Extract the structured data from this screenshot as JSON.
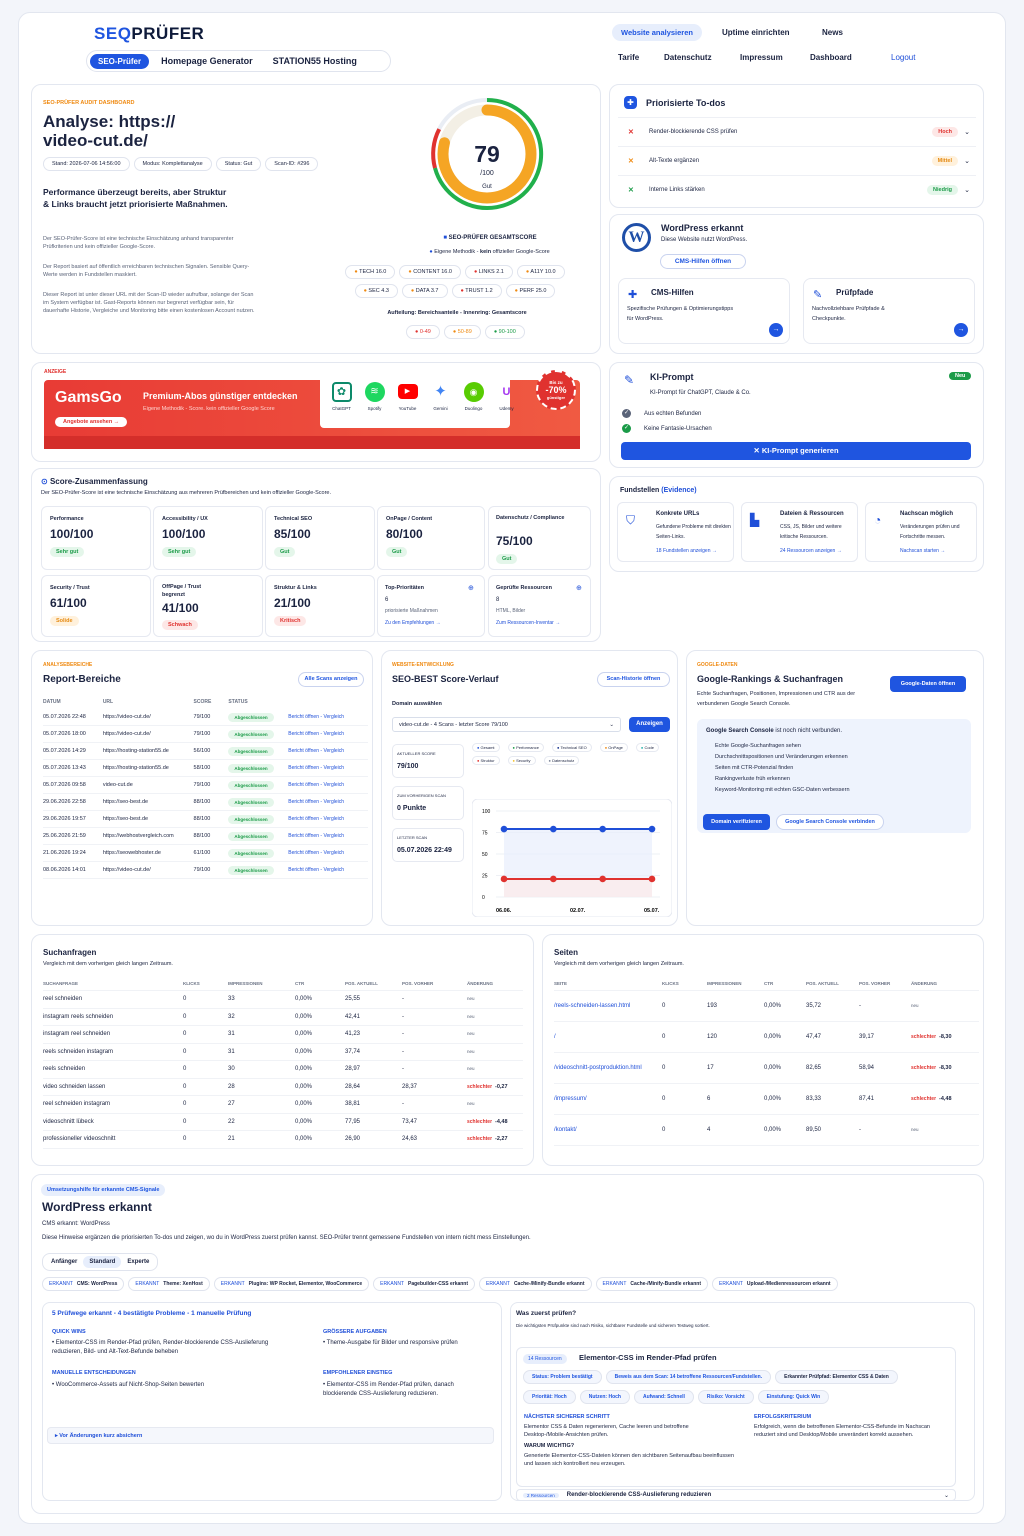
{
  "brand": {
    "seo": "SE",
    "o": "Q",
    "rest": "PRÜFER"
  },
  "topnav": {
    "tabs": [
      "SEO-Prüfer",
      "Homepage Generator",
      "STATION55 Hosting"
    ],
    "links_row1": [
      "Website analysieren",
      "Uptime einrichten",
      "News"
    ],
    "links_row2": [
      "Tarife",
      "Datenschutz",
      "Impressum",
      "Dashboard",
      "Logout"
    ]
  },
  "audit": {
    "kicker": "SEO-PRÜFER AUDIT DASHBOARD",
    "title_line1": "Analyse: https://",
    "title_line2": "video-cut.de/",
    "meta": [
      "Stand: 2026-07-06 14:56:00",
      "Modus: Komplettanalyse",
      "Status: Gut",
      "Scan-ID: #296"
    ],
    "headline": "Performance überzeugt bereits, aber Struktur & Links braucht jetzt priorisierte Maßnahmen.",
    "p1": "Der SEO-Prüfer-Score ist eine technische Einschätzung anhand transparenter Prüfkriterien und kein offizieller Google-Score.",
    "p2": "Der Report basiert auf öffentlich erreichbaren technischen Signalen. Sensible Query-Werte werden in Fundstellen maskiert.",
    "p3": "Dieser Report ist unter dieser URL mit der Scan-ID wieder aufrufbar, solange der Scan im System verfügbar ist. Gast-Reports können nur begrenzt verfügbar sein, für dauerhafte Historie, Vergleiche und Monitoring bitte einen kostenlosen Account nutzen.",
    "score": "79",
    "score_max": "/100",
    "score_label": "Gut",
    "score_value": 79,
    "gesamt": "SEO-PRÜFER GESAMTSCORE",
    "method_a": "Eigene Methodik - ",
    "method_b": "kein",
    "method_c": " offizieller Google-Score",
    "chips": [
      "TECH 16.0",
      "CONTENT 16.0",
      "LINKS 2.1",
      "A11Y 10.0",
      "SEC 4.3",
      "DATA 3.7",
      "TRUST 1.2",
      "PERF 25.0"
    ],
    "legend_title": "Aufteilung: Bereichsanteile - Innenring: Gesamtscore",
    "legend": [
      "0-49",
      "50-89",
      "90-100"
    ]
  },
  "todos": {
    "title": "Priorisierte To-dos",
    "items": [
      {
        "label": "Render-blockierende CSS prüfen",
        "tag": "Hoch"
      },
      {
        "label": "Alt-Texte ergänzen",
        "tag": "Mittel"
      },
      {
        "label": "Interne Links stärken",
        "tag": "Niedrig"
      }
    ]
  },
  "wp": {
    "title": "WordPress erkannt",
    "sub": "Diese Website nutzt WordPress.",
    "btn": "CMS-Hilfen öffnen",
    "cms_title": "CMS-Hilfen",
    "cms_text": "Spezifische Prüfungen & Optimierungstipps für WordPress.",
    "pp_title": "Prüfpfade",
    "pp_text": "Nachvollziehbare Prüfpfade & Checkpunkte."
  },
  "ad": {
    "label": "ANZEIGE",
    "brand": "GamsGo",
    "title": "Premium-Abos günstiger entdecken",
    "sub": "Eigene Methodik - Score. kein offizieller Google Score",
    "cta": "Angebote ansehen →",
    "apps": [
      "ChatGPT",
      "Spotify",
      "YouTube",
      "Gemini",
      "Duolingo",
      "Udemy"
    ],
    "badge1": "Bis zu",
    "badge2": "-70%",
    "badge3": "günstiger"
  },
  "ki": {
    "title": "KI-Prompt",
    "badge": "Neu",
    "sub": "KI-Prompt für ChatGPT, Claude & Co.",
    "c1": "Aus echten Befunden",
    "c2": "Keine Fantasie-Ursachen",
    "btn": "KI-Prompt generieren"
  },
  "fund": {
    "title_a": "Fundstellen ",
    "title_b": "(Evidence)",
    "items": [
      {
        "title": "Konkrete URLs",
        "text": "Gefundene Probleme mit direkten Seiten-Links.",
        "link": "18 Fundstellen anzeigen →"
      },
      {
        "title": "Dateien & Ressourcen",
        "text": "CSS, JS, Bilder und weitere kritische Ressourcen.",
        "link": "24 Ressourcen anzeigen →"
      },
      {
        "title": "Nachscan möglich",
        "text": "Veränderungen prüfen und Fortschritte messen.",
        "link": "Nachscan starten →"
      }
    ]
  },
  "summary": {
    "title": "Score-Zusammenfassung",
    "sub": "Der SEO-Prüfer-Score ist eine technische Einschätzung aus mehreren Prüfbereichen und kein offizieller Google-Score.",
    "cards": [
      {
        "label": "Performance",
        "value": "100/100",
        "tag": "Sehr gut",
        "c": "g"
      },
      {
        "label": "Accessibility / UX",
        "value": "100/100",
        "tag": "Sehr gut",
        "c": "g"
      },
      {
        "label": "Technical SEO",
        "value": "85/100",
        "tag": "Gut",
        "c": "g"
      },
      {
        "label": "OnPage / Content",
        "value": "80/100",
        "tag": "Gut",
        "c": "g"
      },
      {
        "label": "Datenschutz / Compliance",
        "value": "75/100",
        "tag": "Gut",
        "c": "g"
      },
      {
        "label": "Security / Trust",
        "value": "61/100",
        "tag": "Solide",
        "c": "o"
      },
      {
        "label": "OffPage / Trust begrenzt",
        "value": "41/100",
        "tag": "Schwach",
        "c": "r"
      },
      {
        "label": "Struktur & Links",
        "value": "21/100",
        "tag": "Kritisch",
        "c": "r"
      }
    ],
    "top_label": "Top-Prioritäten",
    "top_num": "6",
    "top_sub": "priorisierte Maßnahmen",
    "top_link": "Zu den Empfehlungen →",
    "res_label": "Geprüfte Ressourcen",
    "res_num": "8",
    "res_sub": "HTML, Bilder",
    "res_link": "Zum Ressourcen-Inventar →"
  },
  "report": {
    "kicker": "ANALYSEBEREICHE",
    "title": "Report-Bereiche",
    "btn": "Alle Scans anzeigen",
    "cols": [
      "DATUM",
      "URL",
      "SCORE",
      "STATUS",
      ""
    ],
    "rows": [
      [
        "05.07.2026 22:48",
        "https://video-cut.de/",
        "79/100"
      ],
      [
        "05.07.2026 18:00",
        "https://video-cut.de/",
        "79/100"
      ],
      [
        "05.07.2026 14:29",
        "https://hosting-station55.de",
        "56/100"
      ],
      [
        "05.07.2026 13:43",
        "https://hosting-station55.de",
        "58/100"
      ],
      [
        "05.07.2026 09:58",
        "video-cut.de",
        "79/100"
      ],
      [
        "29.06.2026 22:58",
        "https://seo-best.de",
        "88/100"
      ],
      [
        "29.06.2026 19:57",
        "https://seo-best.de",
        "88/100"
      ],
      [
        "25.06.2026 21:59",
        "https://webhostvergleich.com",
        "88/100"
      ],
      [
        "21.06.2026 19:24",
        "https://seowebhoster.de",
        "61/100"
      ],
      [
        "08.06.2026 14:01",
        "https://video-cut.de/",
        "79/100"
      ]
    ],
    "status": "Abgeschlossen",
    "link": "Bericht öffnen - Vergleich"
  },
  "verlauf": {
    "kicker": "WEBSITE-ENTWICKLUNG",
    "title": "SEO-BEST Score-Verlauf",
    "btn": "Scan-Historie öffnen",
    "select_label": "Domain auswählen",
    "select": "video-cut.de - 4 Scans - letzter Score 79/100",
    "show": "Anzeigen",
    "stats": [
      {
        "l": "AKTUELLER SCORE",
        "v": "79/100"
      },
      {
        "l": "ZUM VORHERIGEN SCAN",
        "v": "0 Punkte"
      },
      {
        "l": "LETZTER SCAN",
        "v": "05.07.2026 22:49"
      }
    ],
    "legend": [
      "Gesamt",
      "Performance",
      "Technical SEO",
      "OnPage",
      "Code",
      "Struktur",
      "Security",
      "Datenschutz"
    ],
    "legend_colors": [
      "#1f4fd8",
      "#1b9b48",
      "#0e2a8a",
      "#ef8a12",
      "#1fb0a8",
      "#e0322f",
      "#f2c230",
      "#7b8498"
    ],
    "yticks": [
      "100",
      "75",
      "50",
      "25",
      "0"
    ],
    "xticks": [
      "06.06.",
      "02.07.",
      "05.07."
    ]
  },
  "chart_data": {
    "type": "line",
    "x": [
      "06.06.",
      "02.07.",
      "05.07."
    ],
    "series": [
      {
        "name": "Gesamt",
        "values": [
          79,
          79,
          79,
          79
        ]
      },
      {
        "name": "Struktur",
        "values": [
          21,
          21,
          21,
          21
        ]
      }
    ],
    "ylim": [
      0,
      100
    ]
  },
  "google": {
    "kicker": "GOOGLE-DATEN",
    "title": "Google-Rankings & Suchanfragen",
    "btn": "Google-Daten öffnen",
    "sub": "Echte Suchanfragen, Positionen, Impressionen und CTR aus der verbundenen Google Search Console.",
    "box_a": "Google Search Console",
    "box_b": " ist noch nicht verbunden.",
    "bullets": [
      "Echte Google-Suchanfragen sehen",
      "Durchschnittspositionen und Veränderungen erkennen",
      "Seiten mit CTR-Potenzial finden",
      "Rankingverluste früh erkennen",
      "Keyword-Monitoring mit echten GSC-Daten verbessern"
    ],
    "b1": "Domain verifizieren",
    "b2": "Google Search Console verbinden"
  },
  "suchanfragen": {
    "title": "Suchanfragen",
    "sub": "Vergleich mit dem vorherigen gleich langen Zeitraum.",
    "cols": [
      "SUCHANFRAGE",
      "KLICKS",
      "IMPRESSIONEN",
      "CTR",
      "POS. AKTUELL",
      "POS. VORHER",
      "ÄNDERUNG"
    ],
    "rows": [
      [
        "reel schneiden",
        "0",
        "33",
        "0,00%",
        "25,55",
        "-",
        "neu",
        ""
      ],
      [
        "instagram reels schneiden",
        "0",
        "32",
        "0,00%",
        "42,41",
        "-",
        "neu",
        ""
      ],
      [
        "instagram reel schneiden",
        "0",
        "31",
        "0,00%",
        "41,23",
        "-",
        "neu",
        ""
      ],
      [
        "reels schneiden instagram",
        "0",
        "31",
        "0,00%",
        "37,74",
        "-",
        "neu",
        ""
      ],
      [
        "reels schneiden",
        "0",
        "30",
        "0,00%",
        "28,97",
        "-",
        "neu",
        ""
      ],
      [
        "video schneiden lassen",
        "0",
        "28",
        "0,00%",
        "28,64",
        "28,37",
        "schlechter",
        "-0,27"
      ],
      [
        "reel schneiden instagram",
        "0",
        "27",
        "0,00%",
        "38,81",
        "-",
        "neu",
        ""
      ],
      [
        "videoschnitt lübeck",
        "0",
        "22",
        "0,00%",
        "77,95",
        "73,47",
        "schlechter",
        "-4,48"
      ],
      [
        "professioneller videoschnitt",
        "0",
        "21",
        "0,00%",
        "26,90",
        "24,63",
        "schlechter",
        "-2,27"
      ]
    ]
  },
  "seiten": {
    "title": "Seiten",
    "sub": "Vergleich mit dem vorherigen gleich langen Zeitraum.",
    "cols": [
      "SEITE",
      "KLICKS",
      "IMPRESSIONEN",
      "CTR",
      "POS. AKTUELL",
      "POS. VORHER",
      "ÄNDERUNG"
    ],
    "rows": [
      [
        "/reels-schneiden-lassen.html",
        "0",
        "193",
        "0,00%",
        "35,72",
        "-",
        "neu",
        ""
      ],
      [
        "/",
        "0",
        "120",
        "0,00%",
        "47,47",
        "39,17",
        "schlechter",
        "-8,30"
      ],
      [
        "/videoschnitt-postproduktion.html",
        "0",
        "17",
        "0,00%",
        "82,65",
        "58,94",
        "schlechter",
        "-8,30"
      ],
      [
        "/impressum/",
        "0",
        "6",
        "0,00%",
        "83,33",
        "87,41",
        "schlechter",
        "-4,48"
      ],
      [
        "/kontakt/",
        "0",
        "4",
        "0,00%",
        "89,50",
        "-",
        "neu",
        ""
      ]
    ]
  },
  "cms": {
    "kicker": "Umsetzungshilfe für erkannte CMS-Signale",
    "title": "WordPress erkannt",
    "sub": "CMS erkannt: WordPress",
    "desc": "Diese Hinweise ergänzen die priorisierten To-dos und zeigen, wo du in WordPress zuerst prüfen kannst. SEO-Prüfer trennt gemessene Fundstellen von intern nicht mess Einstellungen.",
    "levels": [
      "Anfänger",
      "Standard",
      "Experte"
    ],
    "detect": [
      [
        "ERKANNT",
        "CMS: WordPress"
      ],
      [
        "ERKANNT",
        "Theme: XenHost"
      ],
      [
        "ERKANNT",
        "Plugins: WP Rocket, Elementor, WooCommerce"
      ],
      [
        "ERKANNT",
        "Pagebuilder-CSS erkannt"
      ],
      [
        "ERKANNT",
        "Cache-/Minify-Bundle erkannt"
      ],
      [
        "ERKANNT",
        "Cache-/Minify-Bundle erkannt"
      ],
      [
        "ERKANNT",
        "Upload-/Medienressourcen erkannt"
      ]
    ],
    "pw_title": "5 Prüfwege erkannt - 4 bestätigte Probleme - 1 manuelle Prüfung",
    "qw": "QUICK WINS",
    "qw_t": "Elementor-CSS im Render-Pfad prüfen, Render-blockierende CSS-Auslieferung reduzieren, Bild- und Alt-Text-Befunde beheben",
    "ga": "GRÖSSERE AUFGABEN",
    "ga_t": "Theme-Ausgabe für Bilder und responsive prüfen",
    "me": "MANUELLE ENTSCHEIDUNGEN",
    "me_t": "WooCommerce-Assets auf Nicht-Shop-Seiten bewerten",
    "ee": "EMPFOHLENER EINSTIEG",
    "ee_t": "Elementor-CSS im Render-Pfad prüfen, danach blockierende CSS-Auslieferung reduzieren.",
    "acc": "▸ Vor Änderungen kurz absichern",
    "wz_title": "Was zuerst prüfen?",
    "wz_sub": "Die wichtigsten Prüfpunkte sind nach Risiko, sichtbarer Fundstelle und sicherem Testweg sortiert.",
    "res": "14 Ressourcen",
    "el_title": "Elementor-CSS im Render-Pfad prüfen",
    "tags": [
      "Status: Problem bestätigt",
      "Beweis aus dem Scan: 14 betroffene Ressourcen/Fundstellen.",
      "Erkannter Prüfpfad: Elementor CSS & Daten",
      "Priorität: Hoch",
      "Nutzen: Hoch",
      "Aufwand: Schnell",
      "Risiko: Vorsicht",
      "Einstufung: Quick Win"
    ],
    "ns_t": "NÄCHSTER SICHERER SCHRITT",
    "ns": "Elementor CSS & Daten regenerieren, Cache leeren und betroffene Desktop-/Mobile-Ansichten prüfen.",
    "ww_t": "WARUM WICHTIG?",
    "ww": "Generierte Elementor-CSS-Dateien können den sichtbaren Seitenaufbau beeinflussen und lassen sich kontrolliert neu erzeugen.",
    "ek_t": "ERFOLGSKRITERIUM",
    "ek": "Erfolgreich, wenn die betroffenen Elementor-CSS-Befunde im Nachscan reduziert sind und Desktop/Mobile unverändert korrekt aussehen.",
    "foot_res": "2 Ressourcen",
    "foot": "Render-blockierende CSS-Auslieferung reduzieren"
  }
}
